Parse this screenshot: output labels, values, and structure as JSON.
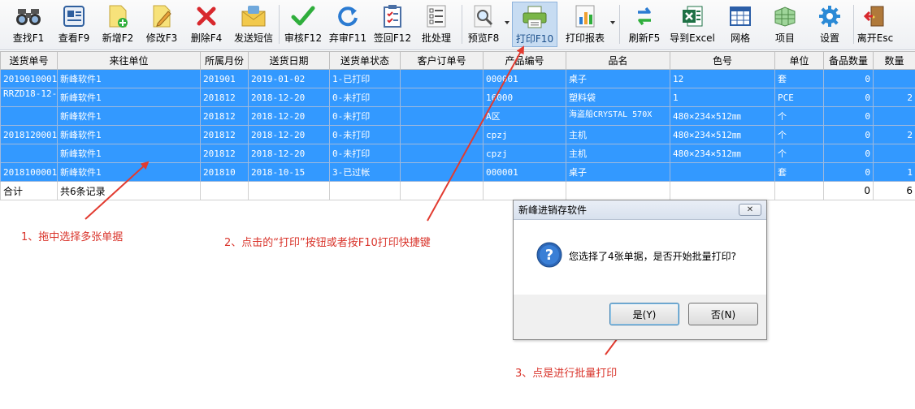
{
  "toolbar": {
    "buttons": [
      {
        "label": "查找F1",
        "icon": "binoculars-icon"
      },
      {
        "label": "查看F9",
        "icon": "view-card-icon"
      },
      {
        "label": "新增F2",
        "icon": "new-document-icon"
      },
      {
        "label": "修改F3",
        "icon": "edit-document-icon"
      },
      {
        "label": "删除F4",
        "icon": "delete-x-icon"
      },
      {
        "label": "发送短信",
        "icon": "sms-envelope-icon"
      },
      {
        "label": "审核F12",
        "icon": "checkmark-icon"
      },
      {
        "label": "弃审F11",
        "icon": "refresh-undo-icon"
      },
      {
        "label": "签回F12",
        "icon": "clipboard-check-icon"
      },
      {
        "label": "批处理",
        "icon": "checklist-icon"
      },
      {
        "label": "预览F8",
        "icon": "magnifier-preview-icon"
      },
      {
        "label": "打印F10",
        "icon": "printer-icon"
      },
      {
        "label": "打印报表",
        "icon": "report-chart-icon"
      },
      {
        "label": "刷新F5",
        "icon": "refresh-arrows-icon"
      },
      {
        "label": "导到Excel",
        "icon": "excel-icon"
      },
      {
        "label": "网格",
        "icon": "grid-icon"
      },
      {
        "label": "项目",
        "icon": "project-table-icon"
      },
      {
        "label": "设置",
        "icon": "gear-icon"
      },
      {
        "label": "离开Esc",
        "icon": "exit-door-icon"
      }
    ]
  },
  "grid": {
    "columns": [
      "送货单号",
      "来往单位",
      "所属月份",
      "送货日期",
      "送货单状态",
      "客户订单号",
      "产品编号",
      "品名",
      "色号",
      "单位",
      "备品数量",
      "数量"
    ],
    "rows": [
      [
        "2019010001",
        "新峰软件1",
        "201901",
        "2019-01-02",
        "1-已打印",
        "",
        "000001",
        "桌子",
        "12",
        "套",
        "0",
        ""
      ],
      [
        "RRZD18-12-",
        "新峰软件1",
        "201812",
        "2018-12-20",
        "0-未打印",
        "",
        "16000",
        "塑料袋",
        "1",
        "PCE",
        "0",
        "2"
      ],
      [
        "",
        "新峰软件1",
        "201812",
        "2018-12-20",
        "0-未打印",
        "",
        "A区",
        "海盗船CRYSTAL 570X",
        "480×234×512㎜",
        "个",
        "0",
        ""
      ],
      [
        "2018120001",
        "新峰软件1",
        "201812",
        "2018-12-20",
        "0-未打印",
        "",
        "cpzj",
        "主机",
        "480×234×512㎜",
        "个",
        "0",
        "2"
      ],
      [
        "",
        "新峰软件1",
        "201812",
        "2018-12-20",
        "0-未打印",
        "",
        "cpzj",
        "主机",
        "480×234×512㎜",
        "个",
        "0",
        ""
      ],
      [
        "2018100001",
        "新峰软件1",
        "201810",
        "2018-10-15",
        "3-已过帐",
        "",
        "000001",
        "桌子",
        "",
        "套",
        "0",
        "1"
      ]
    ],
    "total": {
      "label": "合计",
      "summary": "共6条记录",
      "spare_total": "0",
      "qty_total": "6"
    }
  },
  "annotations": {
    "note1": "1、拖中选择多张单据",
    "note2": "2、点击的“打印”按钮或者按F10打印快捷键",
    "note3": "3、点是进行批量打印"
  },
  "dialog": {
    "title": "新峰进销存软件",
    "message": "您选择了4张单据，是否开始批量打印?",
    "yes_label": "是(Y)",
    "no_label": "否(N)",
    "close_glyph": "✕"
  },
  "colors": {
    "selection": "#3399ff",
    "annotation": "#d9342b"
  }
}
